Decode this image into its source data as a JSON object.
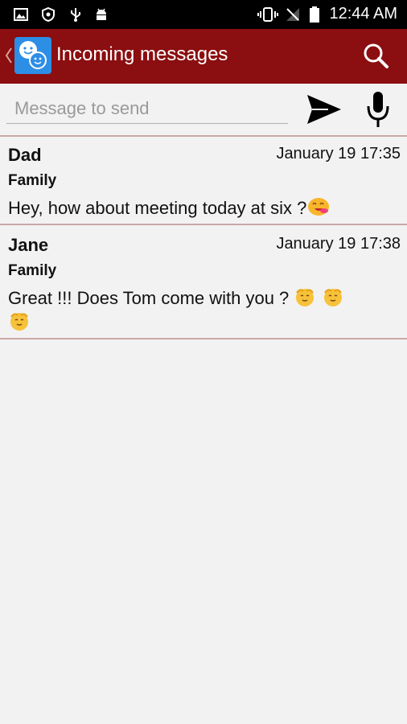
{
  "status_bar": {
    "time": "12:44 AM",
    "icons": [
      "image-icon",
      "shield-icon",
      "usb-icon",
      "android-icon",
      "vibrate-icon",
      "no-signal-icon",
      "battery-icon"
    ]
  },
  "app_bar": {
    "title": "Incoming messages",
    "icons": [
      "back-chevron-icon",
      "chat-app-icon",
      "search-icon"
    ],
    "color": "#8b0e10"
  },
  "compose": {
    "placeholder": "Message to send",
    "value": "",
    "icons": [
      "send-icon",
      "microphone-icon"
    ]
  },
  "messages": [
    {
      "sender": "Dad",
      "date": "January 19 17:35",
      "group": "Family",
      "text": "Hey, how about meeting today at six ?",
      "emojis": [
        "winking-face-emoji"
      ]
    },
    {
      "sender": "Jane",
      "date": "January 19 17:38",
      "group": "Family",
      "text": "Great !!! Does Tom come with you ?",
      "emojis": [
        "smiling-face-emoji",
        "smiling-face-emoji",
        "smiling-face-emoji"
      ]
    }
  ],
  "colors": {
    "accent": "#8b0e10",
    "divider": "#c9a7a7",
    "background": "#f2f2f2",
    "app_icon": "#2d8ee6"
  }
}
